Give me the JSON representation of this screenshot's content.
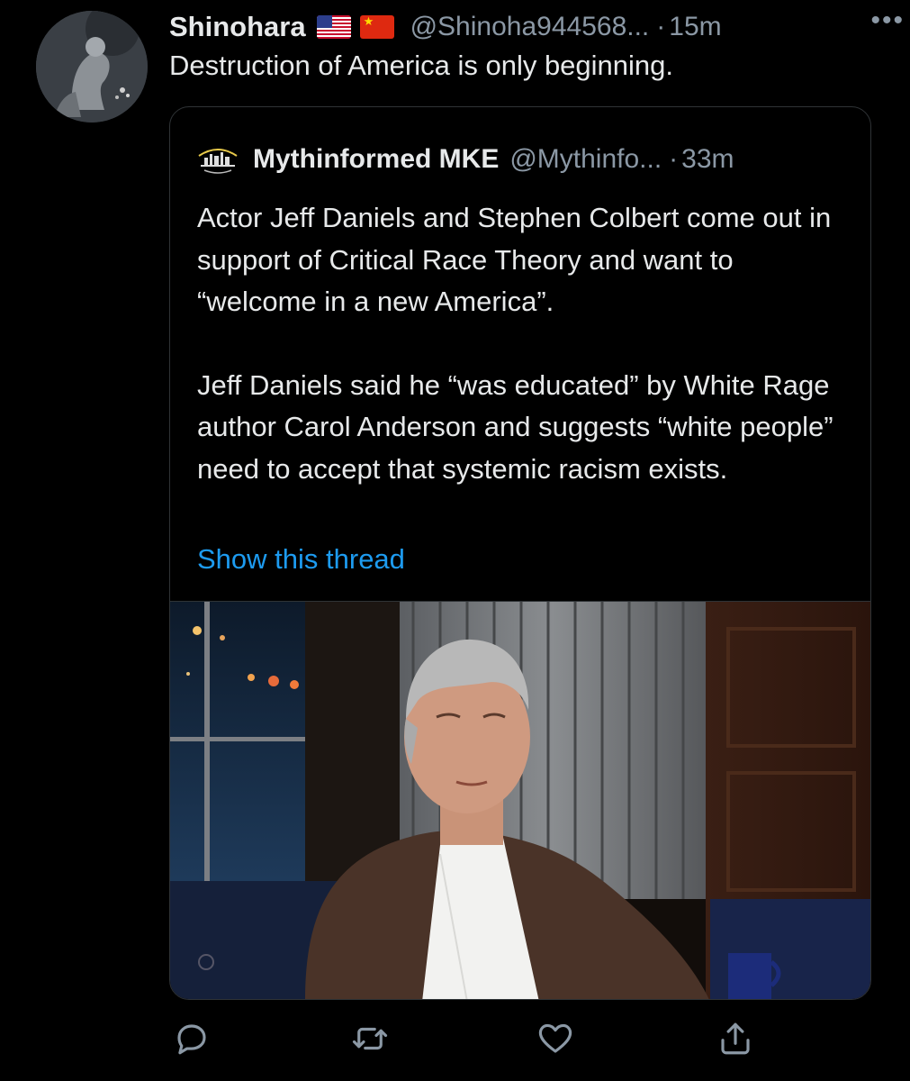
{
  "author": {
    "display_name": "Shinohara",
    "flags": [
      "us-flag",
      "china-flag"
    ],
    "handle": "@Shinoha944568...",
    "separator": "·",
    "time": "15m",
    "more_icon": "more-dots-icon"
  },
  "tweet": {
    "text": "Destruction of America is only beginning."
  },
  "quoted": {
    "display_name": "Mythinformed MKE",
    "handle": "@Mythinfo...",
    "separator": "·",
    "time": "33m",
    "paragraphs": [
      "Actor Jeff Daniels and Stephen Colbert come out in support of Critical Race Theory and want to “welcome in a new America”.",
      "Jeff Daniels said he “was educated” by White Rage author Carol Anderson and suggests “white people” need to accept that systemic racism exists."
    ],
    "show_thread": "Show this thread"
  },
  "actions": [
    "reply-icon",
    "retweet-icon",
    "like-icon",
    "share-icon"
  ],
  "colors": {
    "background": "#000000",
    "text": "#e7e9ea",
    "secondary": "#8b98a5",
    "link": "#1d9bf0",
    "border": "#2f3336"
  }
}
